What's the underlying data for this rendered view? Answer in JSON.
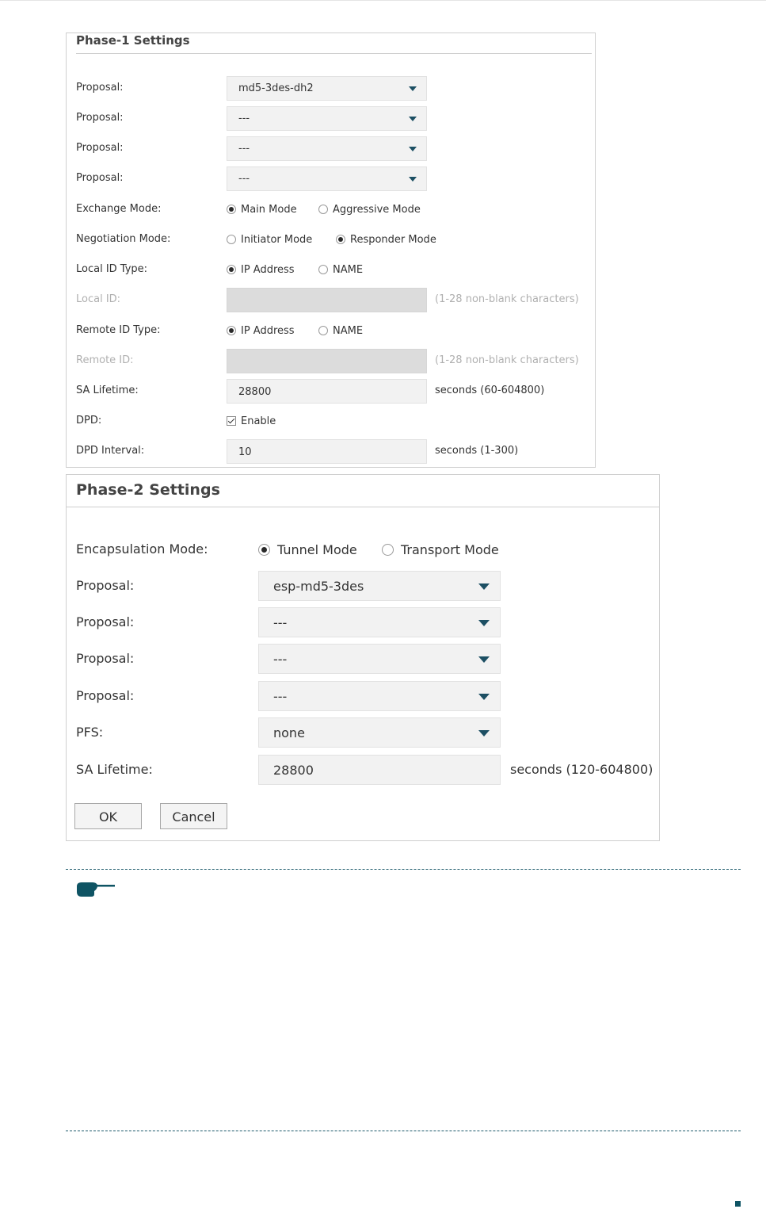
{
  "phase1": {
    "title": "Phase-1 Settings",
    "proposals": [
      {
        "label": "Proposal:",
        "value": "md5-3des-dh2"
      },
      {
        "label": "Proposal:",
        "value": "---"
      },
      {
        "label": "Proposal:",
        "value": "---"
      },
      {
        "label": "Proposal:",
        "value": "---"
      }
    ],
    "exchange_mode": {
      "label": "Exchange Mode:",
      "options": [
        "Main Mode",
        "Aggressive Mode"
      ],
      "selected": "Main Mode"
    },
    "negotiation_mode": {
      "label": "Negotiation Mode:",
      "options": [
        "Initiator Mode",
        "Responder Mode"
      ],
      "selected": "Responder Mode"
    },
    "local_id_type": {
      "label": "Local ID Type:",
      "options": [
        "IP Address",
        "NAME"
      ],
      "selected": "IP Address"
    },
    "local_id": {
      "label": "Local ID:",
      "value": "",
      "hint": "(1-28 non-blank characters)"
    },
    "remote_id_type": {
      "label": "Remote ID Type:",
      "options": [
        "IP Address",
        "NAME"
      ],
      "selected": "IP Address"
    },
    "remote_id": {
      "label": "Remote ID:",
      "value": "",
      "hint": "(1-28 non-blank characters)"
    },
    "sa_lifetime": {
      "label": "SA Lifetime:",
      "value": "28800",
      "hint": "seconds (60-604800)"
    },
    "dpd": {
      "label": "DPD:",
      "checkbox_label": "Enable",
      "checked": true
    },
    "dpd_interval": {
      "label": "DPD Interval:",
      "value": "10",
      "hint": "seconds (1-300)"
    }
  },
  "phase2": {
    "title": "Phase-2 Settings",
    "encapsulation_mode": {
      "label": "Encapsulation Mode:",
      "options": [
        "Tunnel Mode",
        "Transport Mode"
      ],
      "selected": "Tunnel Mode"
    },
    "proposals": [
      {
        "label": "Proposal:",
        "value": "esp-md5-3des"
      },
      {
        "label": "Proposal:",
        "value": "---"
      },
      {
        "label": "Proposal:",
        "value": "---"
      },
      {
        "label": "Proposal:",
        "value": "---"
      }
    ],
    "pfs": {
      "label": "PFS:",
      "value": "none"
    },
    "sa_lifetime": {
      "label": "SA Lifetime:",
      "value": "28800",
      "hint": "seconds (120-604800)"
    },
    "ok_label": "OK",
    "cancel_label": "Cancel"
  },
  "note": {
    "icon": "pointing-hand-icon"
  },
  "colors": {
    "accent": "#1c4f63",
    "dash": "#1e5a6b",
    "panel_border": "#cfcfcf",
    "disabled_field": "#dcdcdc"
  }
}
